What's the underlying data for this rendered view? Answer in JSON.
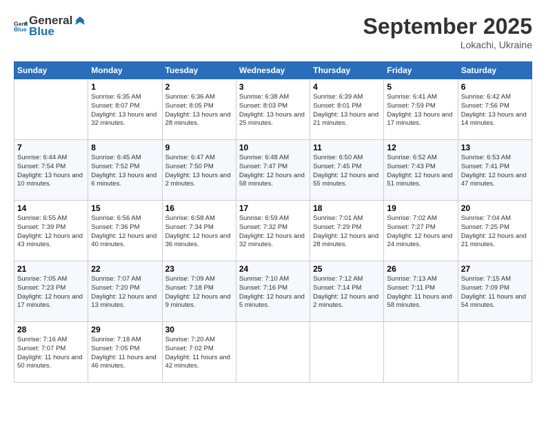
{
  "header": {
    "logo_general": "General",
    "logo_blue": "Blue",
    "title": "September 2025",
    "location": "Lokachi, Ukraine"
  },
  "days_of_week": [
    "Sunday",
    "Monday",
    "Tuesday",
    "Wednesday",
    "Thursday",
    "Friday",
    "Saturday"
  ],
  "weeks": [
    [
      {
        "day": "",
        "info": ""
      },
      {
        "day": "1",
        "info": "Sunrise: 6:35 AM\nSunset: 8:07 PM\nDaylight: 13 hours\nand 32 minutes."
      },
      {
        "day": "2",
        "info": "Sunrise: 6:36 AM\nSunset: 8:05 PM\nDaylight: 13 hours\nand 28 minutes."
      },
      {
        "day": "3",
        "info": "Sunrise: 6:38 AM\nSunset: 8:03 PM\nDaylight: 13 hours\nand 25 minutes."
      },
      {
        "day": "4",
        "info": "Sunrise: 6:39 AM\nSunset: 8:01 PM\nDaylight: 13 hours\nand 21 minutes."
      },
      {
        "day": "5",
        "info": "Sunrise: 6:41 AM\nSunset: 7:59 PM\nDaylight: 13 hours\nand 17 minutes."
      },
      {
        "day": "6",
        "info": "Sunrise: 6:42 AM\nSunset: 7:56 PM\nDaylight: 13 hours\nand 14 minutes."
      }
    ],
    [
      {
        "day": "7",
        "info": "Sunrise: 6:44 AM\nSunset: 7:54 PM\nDaylight: 13 hours\nand 10 minutes."
      },
      {
        "day": "8",
        "info": "Sunrise: 6:45 AM\nSunset: 7:52 PM\nDaylight: 13 hours\nand 6 minutes."
      },
      {
        "day": "9",
        "info": "Sunrise: 6:47 AM\nSunset: 7:50 PM\nDaylight: 13 hours\nand 2 minutes."
      },
      {
        "day": "10",
        "info": "Sunrise: 6:48 AM\nSunset: 7:47 PM\nDaylight: 12 hours\nand 58 minutes."
      },
      {
        "day": "11",
        "info": "Sunrise: 6:50 AM\nSunset: 7:45 PM\nDaylight: 12 hours\nand 55 minutes."
      },
      {
        "day": "12",
        "info": "Sunrise: 6:52 AM\nSunset: 7:43 PM\nDaylight: 12 hours\nand 51 minutes."
      },
      {
        "day": "13",
        "info": "Sunrise: 6:53 AM\nSunset: 7:41 PM\nDaylight: 12 hours\nand 47 minutes."
      }
    ],
    [
      {
        "day": "14",
        "info": "Sunrise: 6:55 AM\nSunset: 7:39 PM\nDaylight: 12 hours\nand 43 minutes."
      },
      {
        "day": "15",
        "info": "Sunrise: 6:56 AM\nSunset: 7:36 PM\nDaylight: 12 hours\nand 40 minutes."
      },
      {
        "day": "16",
        "info": "Sunrise: 6:58 AM\nSunset: 7:34 PM\nDaylight: 12 hours\nand 36 minutes."
      },
      {
        "day": "17",
        "info": "Sunrise: 6:59 AM\nSunset: 7:32 PM\nDaylight: 12 hours\nand 32 minutes."
      },
      {
        "day": "18",
        "info": "Sunrise: 7:01 AM\nSunset: 7:29 PM\nDaylight: 12 hours\nand 28 minutes."
      },
      {
        "day": "19",
        "info": "Sunrise: 7:02 AM\nSunset: 7:27 PM\nDaylight: 12 hours\nand 24 minutes."
      },
      {
        "day": "20",
        "info": "Sunrise: 7:04 AM\nSunset: 7:25 PM\nDaylight: 12 hours\nand 21 minutes."
      }
    ],
    [
      {
        "day": "21",
        "info": "Sunrise: 7:05 AM\nSunset: 7:23 PM\nDaylight: 12 hours\nand 17 minutes."
      },
      {
        "day": "22",
        "info": "Sunrise: 7:07 AM\nSunset: 7:20 PM\nDaylight: 12 hours\nand 13 minutes."
      },
      {
        "day": "23",
        "info": "Sunrise: 7:09 AM\nSunset: 7:18 PM\nDaylight: 12 hours\nand 9 minutes."
      },
      {
        "day": "24",
        "info": "Sunrise: 7:10 AM\nSunset: 7:16 PM\nDaylight: 12 hours\nand 5 minutes."
      },
      {
        "day": "25",
        "info": "Sunrise: 7:12 AM\nSunset: 7:14 PM\nDaylight: 12 hours\nand 2 minutes."
      },
      {
        "day": "26",
        "info": "Sunrise: 7:13 AM\nSunset: 7:11 PM\nDaylight: 11 hours\nand 58 minutes."
      },
      {
        "day": "27",
        "info": "Sunrise: 7:15 AM\nSunset: 7:09 PM\nDaylight: 11 hours\nand 54 minutes."
      }
    ],
    [
      {
        "day": "28",
        "info": "Sunrise: 7:16 AM\nSunset: 7:07 PM\nDaylight: 11 hours\nand 50 minutes."
      },
      {
        "day": "29",
        "info": "Sunrise: 7:18 AM\nSunset: 7:05 PM\nDaylight: 11 hours\nand 46 minutes."
      },
      {
        "day": "30",
        "info": "Sunrise: 7:20 AM\nSunset: 7:02 PM\nDaylight: 11 hours\nand 42 minutes."
      },
      {
        "day": "",
        "info": ""
      },
      {
        "day": "",
        "info": ""
      },
      {
        "day": "",
        "info": ""
      },
      {
        "day": "",
        "info": ""
      }
    ]
  ]
}
